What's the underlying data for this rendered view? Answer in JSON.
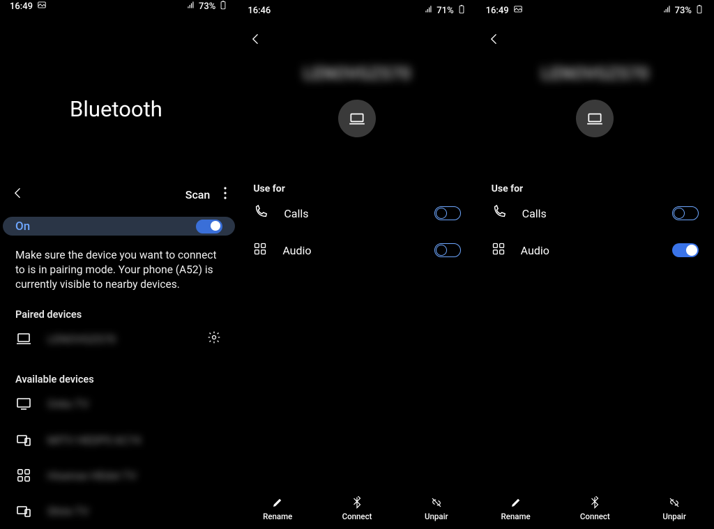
{
  "panels": [
    {
      "status": {
        "time": "16:49",
        "has_screenshot_icon": true,
        "battery": "73%"
      },
      "title": "Bluetooth",
      "scan_label": "Scan",
      "toggle": {
        "label": "On",
        "state": "on"
      },
      "helper": "Make sure the device you want to connect to is in pairing mode. Your phone (A52) is currently visible to nearby devices.",
      "paired_header": "Paired devices",
      "paired": [
        {
          "icon": "laptop",
          "name": "LENOVGZS70",
          "blurred": true,
          "has_gear": true
        }
      ],
      "available_header": "Available devices",
      "available": [
        {
          "icon": "tv",
          "name": "Onkx TV",
          "blurred": true
        },
        {
          "icon": "devices",
          "name": "MITV HEDPS 6C74",
          "blurred": true
        },
        {
          "icon": "grid",
          "name": "Hisense HEdst TV",
          "blurred": true
        },
        {
          "icon": "devices",
          "name": "Shire TV",
          "blurred": true
        }
      ]
    },
    {
      "status": {
        "time": "16:46",
        "has_screenshot_icon": false,
        "battery": "71%"
      },
      "device_name": "LENOVGZS70",
      "usefor_header": "Use for",
      "options": [
        {
          "icon": "phone",
          "label": "Calls",
          "state": "off"
        },
        {
          "icon": "grid",
          "label": "Audio",
          "state": "off"
        }
      ],
      "actions": [
        {
          "icon": "pencil",
          "label": "Rename"
        },
        {
          "icon": "bluetooth",
          "label": "Connect"
        },
        {
          "icon": "unpair",
          "label": "Unpair"
        }
      ]
    },
    {
      "status": {
        "time": "16:49",
        "has_screenshot_icon": true,
        "battery": "73%"
      },
      "device_name": "LENOVGZS70",
      "usefor_header": "Use for",
      "options": [
        {
          "icon": "phone",
          "label": "Calls",
          "state": "off"
        },
        {
          "icon": "grid",
          "label": "Audio",
          "state": "on-solid"
        }
      ],
      "actions": [
        {
          "icon": "pencil",
          "label": "Rename"
        },
        {
          "icon": "bluetooth",
          "label": "Connect"
        },
        {
          "icon": "unpair",
          "label": "Unpair"
        }
      ]
    }
  ]
}
